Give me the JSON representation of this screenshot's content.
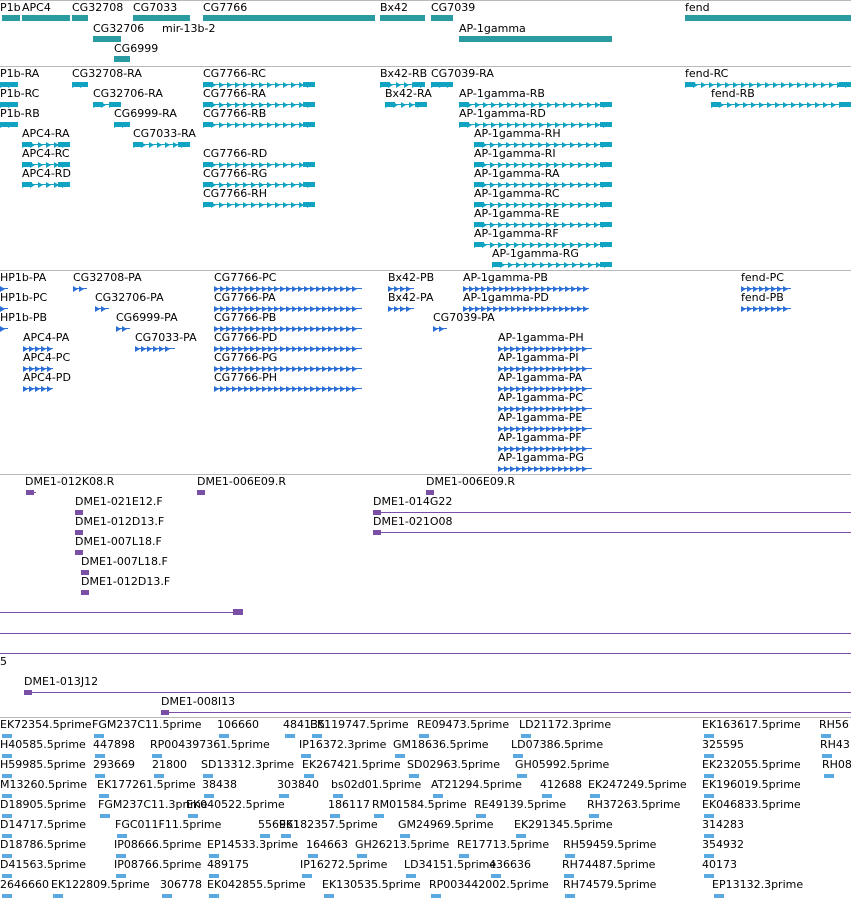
{
  "colors": {
    "gene": "#2a9ba0",
    "transcript": "#10a4c2",
    "protein": "#2c6fd6",
    "clone": "#7b4fa6",
    "est": "#5aa9e0",
    "separator": "#b9b9b9"
  },
  "tracks": {
    "genes": [
      "P1b",
      "APC4",
      "CG32708",
      "CG7033",
      "CG7766",
      "Bx42",
      "CG7039",
      "fend",
      "CG32706",
      "mir-13b-2",
      "AP-1gamma",
      "CG6999"
    ],
    "transcripts": [
      "P1b-RA",
      "CG32708-RA",
      "CG7766-RC",
      "Bx42-RB",
      "CG7039-RA",
      "fend-RC",
      "P1b-RC",
      "CG32706-RA",
      "CG7766-RA",
      "Bx42-RA",
      "AP-1gamma-RB",
      "fend-RB",
      "P1b-RB",
      "CG6999-RA",
      "CG7766-RB",
      "AP-1gamma-RD",
      "APC4-RA",
      "CG7033-RA",
      "AP-1gamma-RH",
      "APC4-RC",
      "AP-1gamma-RI",
      "APC4-RD",
      "CG7766-RD",
      "AP-1gamma-RA",
      "CG7766-RG",
      "AP-1gamma-RC",
      "CG7766-RH",
      "AP-1gamma-RE",
      "AP-1gamma-RF",
      "AP-1gamma-RG"
    ],
    "proteins": [
      "HP1b-PA",
      "CG32708-PA",
      "CG7766-PC",
      "Bx42-PB",
      "AP-1gamma-PB",
      "fend-PC",
      "HP1b-PC",
      "CG32706-PA",
      "CG7766-PA",
      "Bx42-PA",
      "AP-1gamma-PD",
      "fend-PB",
      "HP1b-PB",
      "CG6999-PA",
      "CG7766-PB",
      "CG7039-PA",
      "APC4-PA",
      "CG7033-PA",
      "CG7766-PD",
      "AP-1gamma-PH",
      "APC4-PC",
      "CG7766-PG",
      "AP-1gamma-PI",
      "APC4-PD",
      "CG7766-PH",
      "AP-1gamma-PA",
      "AP-1gamma-PC",
      "AP-1gamma-PE",
      "AP-1gamma-PF",
      "AP-1gamma-PG"
    ],
    "clones": [
      "DME1-012K08.R",
      "DME1-006E09.R",
      "DME1-006E09.R",
      "DME1-021E12.F",
      "DME1-014G22",
      "DME1-012D13.F",
      "DME1-021O08",
      "DME1-007L18.F",
      "DME1-007L18.F",
      "DME1-012D13.F",
      "5",
      "DME1-013J12",
      "DME1-008I13"
    ],
    "ests": [
      [
        "EK72354.5prime",
        "FGM237C11.5prime",
        "106660",
        "484135",
        "EK119747.5prime",
        "RE09473.5prime",
        "LD21172.3prime",
        "EK163617.5prime",
        "RH56"
      ],
      [
        "H40585.5prime",
        "447898",
        "RP004397361.5prime",
        "IP16372.3prime",
        "GM18636.5prime",
        "LD07386.5prime",
        "325595",
        "RH43"
      ],
      [
        "H59985.5prime",
        "293669",
        "21800",
        "SD13312.3prime",
        "EK267421.5prime",
        "SD02963.5prime",
        "GH05992.5prime",
        "EK232055.5prime",
        "RH08"
      ],
      [
        "M13260.5prime",
        "EK177261.5prime",
        "38438",
        "303840",
        "bs02d01.5prime",
        "AT21294.5prime",
        "412688",
        "EK247249.5prime",
        "EK196019.5prime"
      ],
      [
        "D18905.5prime",
        "FGM237C11.3prime",
        "EK040522.5prime",
        "186117",
        "RM01584.5prime",
        "RE49139.5prime",
        "RH37263.5prime",
        "EK046833.5prime"
      ],
      [
        "D14717.5prime",
        "FGC011F11.5prime",
        "556961",
        "EK182357.5prime",
        "GM24969.5prime",
        "EK291345.5prime",
        "314283"
      ],
      [
        "D18786.5prime",
        "IP08666.5prime",
        "EP14533.3prime",
        "164663",
        "GH26213.5prime",
        "RE17713.5prime",
        "RH59459.5prime",
        "354932"
      ],
      [
        "D41563.5prime",
        "IP08766.5prime",
        "489175",
        "IP16272.5prime",
        "LD34151.5prime",
        "436636",
        "RH74487.5prime",
        "40173"
      ],
      [
        "2646660",
        "EK122809.5prime",
        "306778",
        "EK042855.5prime",
        "EK130535.5prime",
        "RP003442002.5prime",
        "RH74579.5prime",
        "EP13132.3prime"
      ]
    ]
  }
}
